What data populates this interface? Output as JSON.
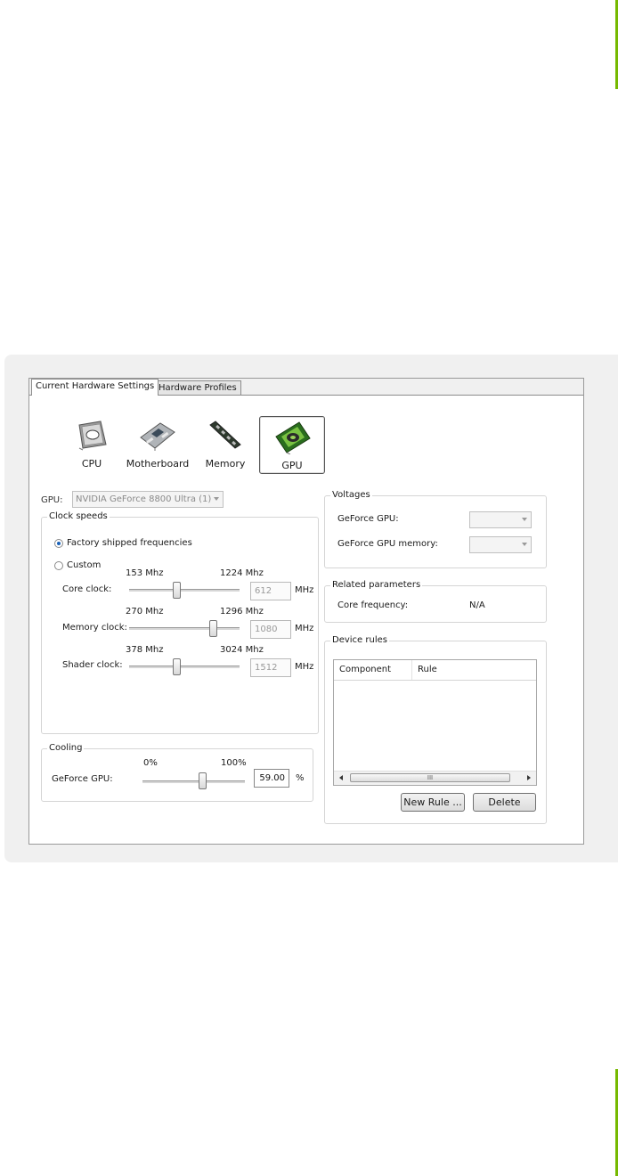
{
  "colors": {
    "accent": "#76b900"
  },
  "tabs": [
    {
      "label": "Current Hardware Settings",
      "active": true
    },
    {
      "label": "Hardware Profiles",
      "active": false
    }
  ],
  "hardware": [
    {
      "label": "CPU",
      "icon": "cpu-chip-icon"
    },
    {
      "label": "Motherboard",
      "icon": "motherboard-icon"
    },
    {
      "label": "Memory",
      "icon": "memory-module-icon"
    },
    {
      "label": "GPU",
      "icon": "gpu-card-icon",
      "selected": true
    }
  ],
  "gpu_select": {
    "label": "GPU:",
    "value": "NVIDIA GeForce 8800 Ultra (1)"
  },
  "clock_speeds": {
    "title": "Clock speeds",
    "factory_label": "Factory shipped frequencies",
    "custom_label": "Custom",
    "selected": "factory",
    "unit": "MHz",
    "core": {
      "label": "Core clock:",
      "min": "153 Mhz",
      "max": "1224 Mhz",
      "value": "612",
      "level": 0.43
    },
    "memory": {
      "label": "Memory clock:",
      "min": "270 Mhz",
      "max": "1296 Mhz",
      "value": "1080",
      "level": 0.76
    },
    "shader": {
      "label": "Shader clock:",
      "min": "378 Mhz",
      "max": "3024 Mhz",
      "value": "1512",
      "level": 0.43
    }
  },
  "cooling": {
    "title": "Cooling",
    "label": "GeForce GPU:",
    "min": "0%",
    "max": "100%",
    "value": "59.00",
    "unit": "%",
    "level": 0.59
  },
  "voltages": {
    "title": "Voltages",
    "gpu_label": "GeForce GPU:",
    "gpu_memory_label": "GeForce GPU memory:"
  },
  "related": {
    "title": "Related parameters",
    "core_label": "Core frequency:",
    "core_value": "N/A"
  },
  "device_rules": {
    "title": "Device rules",
    "columns": [
      "Component",
      "Rule"
    ],
    "scroll_grip": "III",
    "new_rule_label": "New Rule ...",
    "delete_label": "Delete"
  }
}
